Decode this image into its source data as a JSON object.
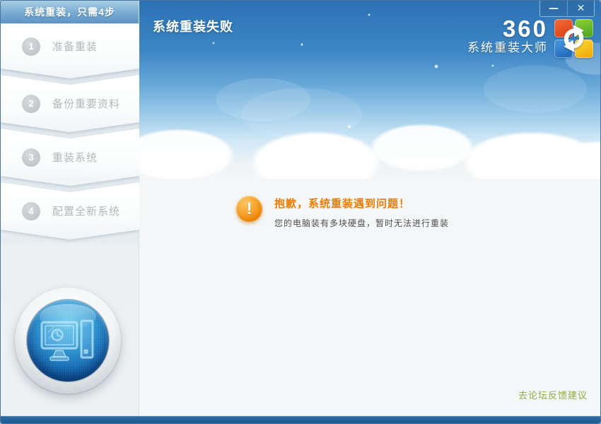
{
  "window": {
    "minimize_label": "—",
    "close_label": "✕"
  },
  "sidebar": {
    "header": "系统重装，只需4步",
    "steps": [
      {
        "num": "1",
        "label": "准备重装"
      },
      {
        "num": "2",
        "label": "备份重要资料"
      },
      {
        "num": "3",
        "label": "重装系统"
      },
      {
        "num": "4",
        "label": "配置全新系统"
      }
    ]
  },
  "header": {
    "title": "系统重装失败",
    "brand_name": "360",
    "brand_subtitle": "系统重装大师"
  },
  "main": {
    "error_icon_glyph": "!",
    "error_title": "抱歉，系统重装遇到问题！",
    "error_detail": "您的电脑装有多块硬盘，暂时无法进行重装"
  },
  "footer": {
    "feedback_link": "去论坛反馈建议"
  },
  "colors": {
    "accent_orange": "#ef7c00",
    "warning_ball": "#f0941c",
    "link_green": "#8fae3b",
    "sky_top": "#2b72b4",
    "bottom_bar": "#1d5991",
    "sidebar_header_blue": "#5d94c2"
  }
}
